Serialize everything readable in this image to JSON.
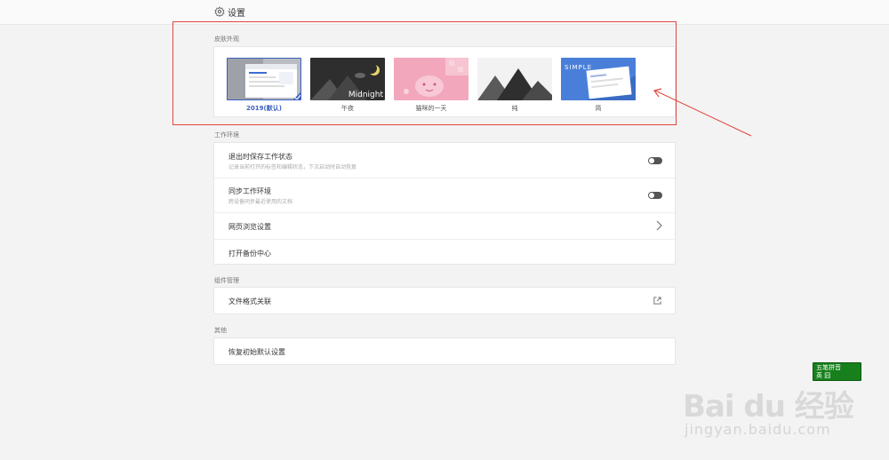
{
  "header": {
    "title": "设置",
    "icon": "gear-icon"
  },
  "skins": {
    "section_label": "皮肤外观",
    "items": [
      {
        "label": "2019(默认)",
        "selected": true
      },
      {
        "label": "午夜",
        "image_text": "Midnight"
      },
      {
        "label": "猫咪的一天"
      },
      {
        "label": "纯"
      },
      {
        "label": "简",
        "image_text": "SIMPLE"
      }
    ]
  },
  "workspace": {
    "section_label": "工作环境",
    "rows": [
      {
        "title": "退出时保存工作状态",
        "subtitle": "记录当前打开的标签和编辑状态，下次启动时自动恢复",
        "control": "toggle",
        "enabled": false
      },
      {
        "title": "同步工作环境",
        "subtitle": "跨设备同步最近使用的文档",
        "control": "toggle",
        "enabled": false
      },
      {
        "title": "网页浏览设置",
        "control": "chevron-right-icon"
      },
      {
        "title": "打开备份中心"
      }
    ]
  },
  "components": {
    "section_label": "组件管理",
    "rows": [
      {
        "title": "文件格式关联",
        "control": "external-link-icon"
      }
    ]
  },
  "other": {
    "section_label": "其他",
    "rows": [
      {
        "title": "恢复初始默认设置"
      }
    ]
  },
  "ime": {
    "line1": "五笔拼音",
    "line2": "英 囧"
  },
  "watermark": {
    "logo_text": "Bai du 经验",
    "url": "jingyan.baidu.com"
  },
  "colors": {
    "accent": "#3b5fc0",
    "highlight": "#e0463f",
    "ime_bg": "#17801c"
  }
}
